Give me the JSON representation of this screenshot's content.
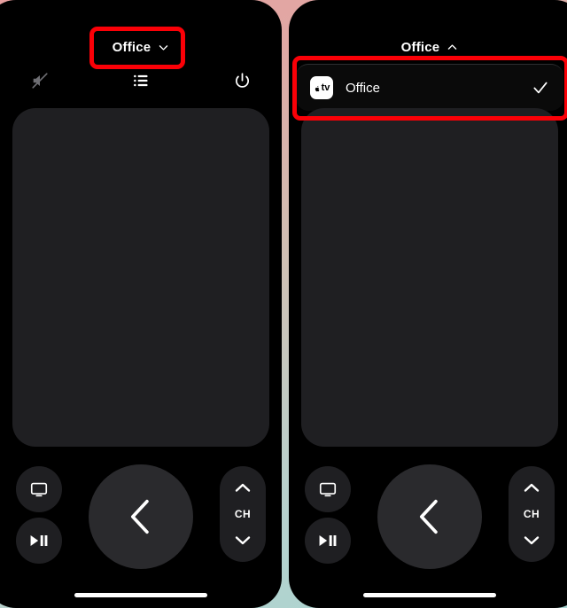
{
  "app": {
    "name": "apple-tv-remote",
    "accent_red": "#fb0007",
    "panel_bg": "#000000",
    "surface_bg": "#1f1f22",
    "dpad_bg": "#2a2a2d"
  },
  "left_panel": {
    "header": {
      "room_name": "Office",
      "chevron": "chevron-down-icon"
    },
    "toolbar": [
      {
        "name": "mute-button",
        "icon": "speaker-mute-icon",
        "state": "muted"
      },
      {
        "name": "menu-list-button",
        "icon": "list-icon"
      },
      {
        "name": "power-button",
        "icon": "power-icon"
      }
    ],
    "touchpad": {
      "label": "touch-surface"
    },
    "controls": {
      "tv_button": {
        "icon": "tv-icon",
        "label": "TV"
      },
      "playpause_button": {
        "icon": "play-pause-icon",
        "label": "Play/Pause"
      },
      "dpad_button": {
        "icon": "chevron-left-icon",
        "label": "Back"
      },
      "channel_rocker": {
        "up_icon": "chevron-up-icon",
        "label": "CH",
        "down_icon": "chevron-down-icon"
      }
    }
  },
  "right_panel": {
    "header": {
      "room_name": "Office",
      "chevron": "chevron-up-icon"
    },
    "dropdown": {
      "items": [
        {
          "icon": "apple-tv-icon",
          "icon_text": "tv",
          "label": "Office",
          "selected": true,
          "check_icon": "checkmark-icon"
        }
      ]
    },
    "touchpad": {
      "label": "touch-surface"
    },
    "controls": {
      "tv_button": {
        "icon": "tv-icon",
        "label": "TV"
      },
      "playpause_button": {
        "icon": "play-pause-icon",
        "label": "Play/Pause"
      },
      "dpad_button": {
        "icon": "chevron-left-icon",
        "label": "Back"
      },
      "channel_rocker": {
        "up_icon": "chevron-up-icon",
        "label": "CH",
        "down_icon": "chevron-down-icon"
      }
    }
  },
  "annotations": [
    {
      "name": "highlight-room-picker",
      "target": "left_panel.header"
    },
    {
      "name": "highlight-device-row",
      "target": "right_panel.dropdown.items.0"
    }
  ]
}
